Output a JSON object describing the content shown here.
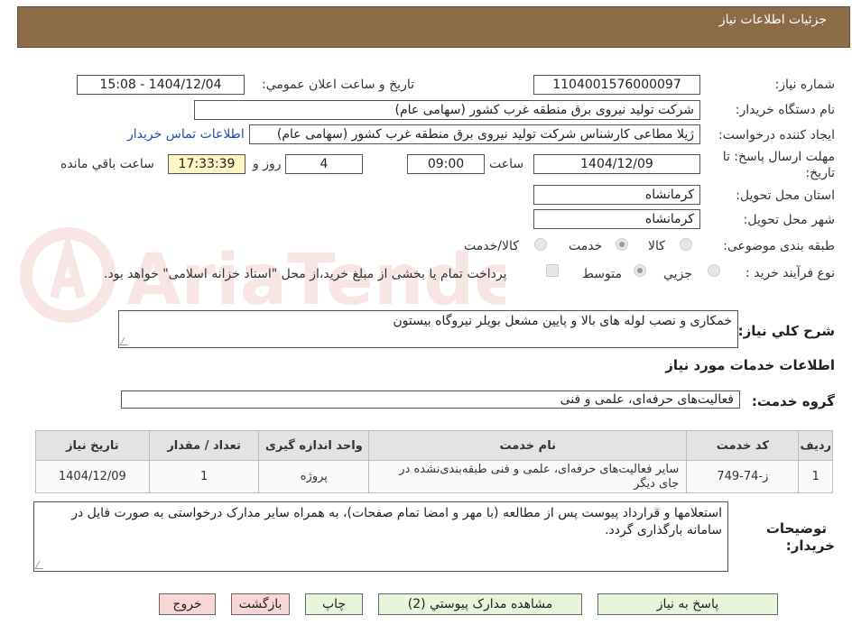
{
  "header": {
    "title": "جزئیات اطلاعات نیاز"
  },
  "form": {
    "need_number_label": "شماره نیاز:",
    "need_number": "1104001576000097",
    "announce_label": "تاریخ و ساعت اعلان عمومي:",
    "announce_value": "1404/12/04 - 15:08",
    "buyer_org_label": "نام دستگاه خریدار:",
    "buyer_org": "شرکت تولید نیروی برق منطقه غرب کشور (سهامی عام)",
    "creator_label": "ایجاد کننده درخواست:",
    "creator": "ژیلا مطاعی کارشناس شرکت تولید نیروی برق منطقه غرب کشور (سهامی عام)",
    "contact_link": "اطلاعات تماس خریدار",
    "deadline_label_1": "مهلت ارسال پاسخ: تا",
    "deadline_label_2": "تاریخ:",
    "deadline_date": "1404/12/09",
    "time_label": "ساعت",
    "deadline_time": "09:00",
    "days_value": "4",
    "days_label": "روز و",
    "remaining_time": "17:33:39",
    "remaining_label": "ساعت باقي مانده",
    "province_label": "استان محل تحویل:",
    "province": "کرمانشاه",
    "city_label": "شهر محل تحویل:",
    "city": "کرمانشاه",
    "category_label": "طبقه بندی موضوعی:",
    "category_options": [
      "کالا",
      "خدمت",
      "کالا/خدمت"
    ],
    "category_selected": "خدمت",
    "process_label": "نوع فرآیند خرید :",
    "process_options": [
      "جزيي",
      "متوسط"
    ],
    "process_selected": "متوسط",
    "payment_note": "پرداخت تمام یا بخشی از مبلغ خرید،از محل \"اسناد خزانه اسلامی\" خواهد بود."
  },
  "summary": {
    "label": "شرح کلي نیاز:",
    "text": "خمکاری و نصب لوله های بالا و پایین مشعل بویلر نیروگاه بیستون"
  },
  "services": {
    "section_title": "اطلاعات خدمات مورد نیاز",
    "group_label": "گروه خدمت:",
    "group_value": "فعالیت‌های حرفه‌ای، علمی و فنی",
    "columns": [
      "ردیف",
      "کد خدمت",
      "نام خدمت",
      "واحد اندازه گیری",
      "تعداد / مقدار",
      "تاریخ نیاز"
    ],
    "rows": [
      [
        "1",
        "ز-74-749",
        "سایر فعالیت‌های حرفه‌ای، علمی و فنی طبقه‌بندی‌نشده در جای دیگر",
        "پروژه",
        "1",
        "1404/12/09"
      ]
    ]
  },
  "buyer_notes": {
    "label_1": "توضیحات",
    "label_2": "خریدار:",
    "text": "استعلامها و قرارداد پیوست پس از مطالعه (با مهر و امضا تمام صفحات)، به همراه سایر مدارک درخواستی به صورت فایل در سامانه بارگذاری گردد."
  },
  "buttons": {
    "reply": "پاسخ به نیاز",
    "attachments": "مشاهده مدارک پیوستي (2)",
    "print": "چاپ",
    "back": "بازگشت",
    "exit": "خروج"
  },
  "colors": {
    "header_bg": "#8b6b48",
    "link": "#1a4fb0",
    "highlight_field": "#fdf5c4",
    "green_button": "#e8f5dd",
    "pink_button": "#f9d7d7",
    "watermark": "#c0392b"
  },
  "watermark": {
    "text": "AriaTender.neT"
  }
}
